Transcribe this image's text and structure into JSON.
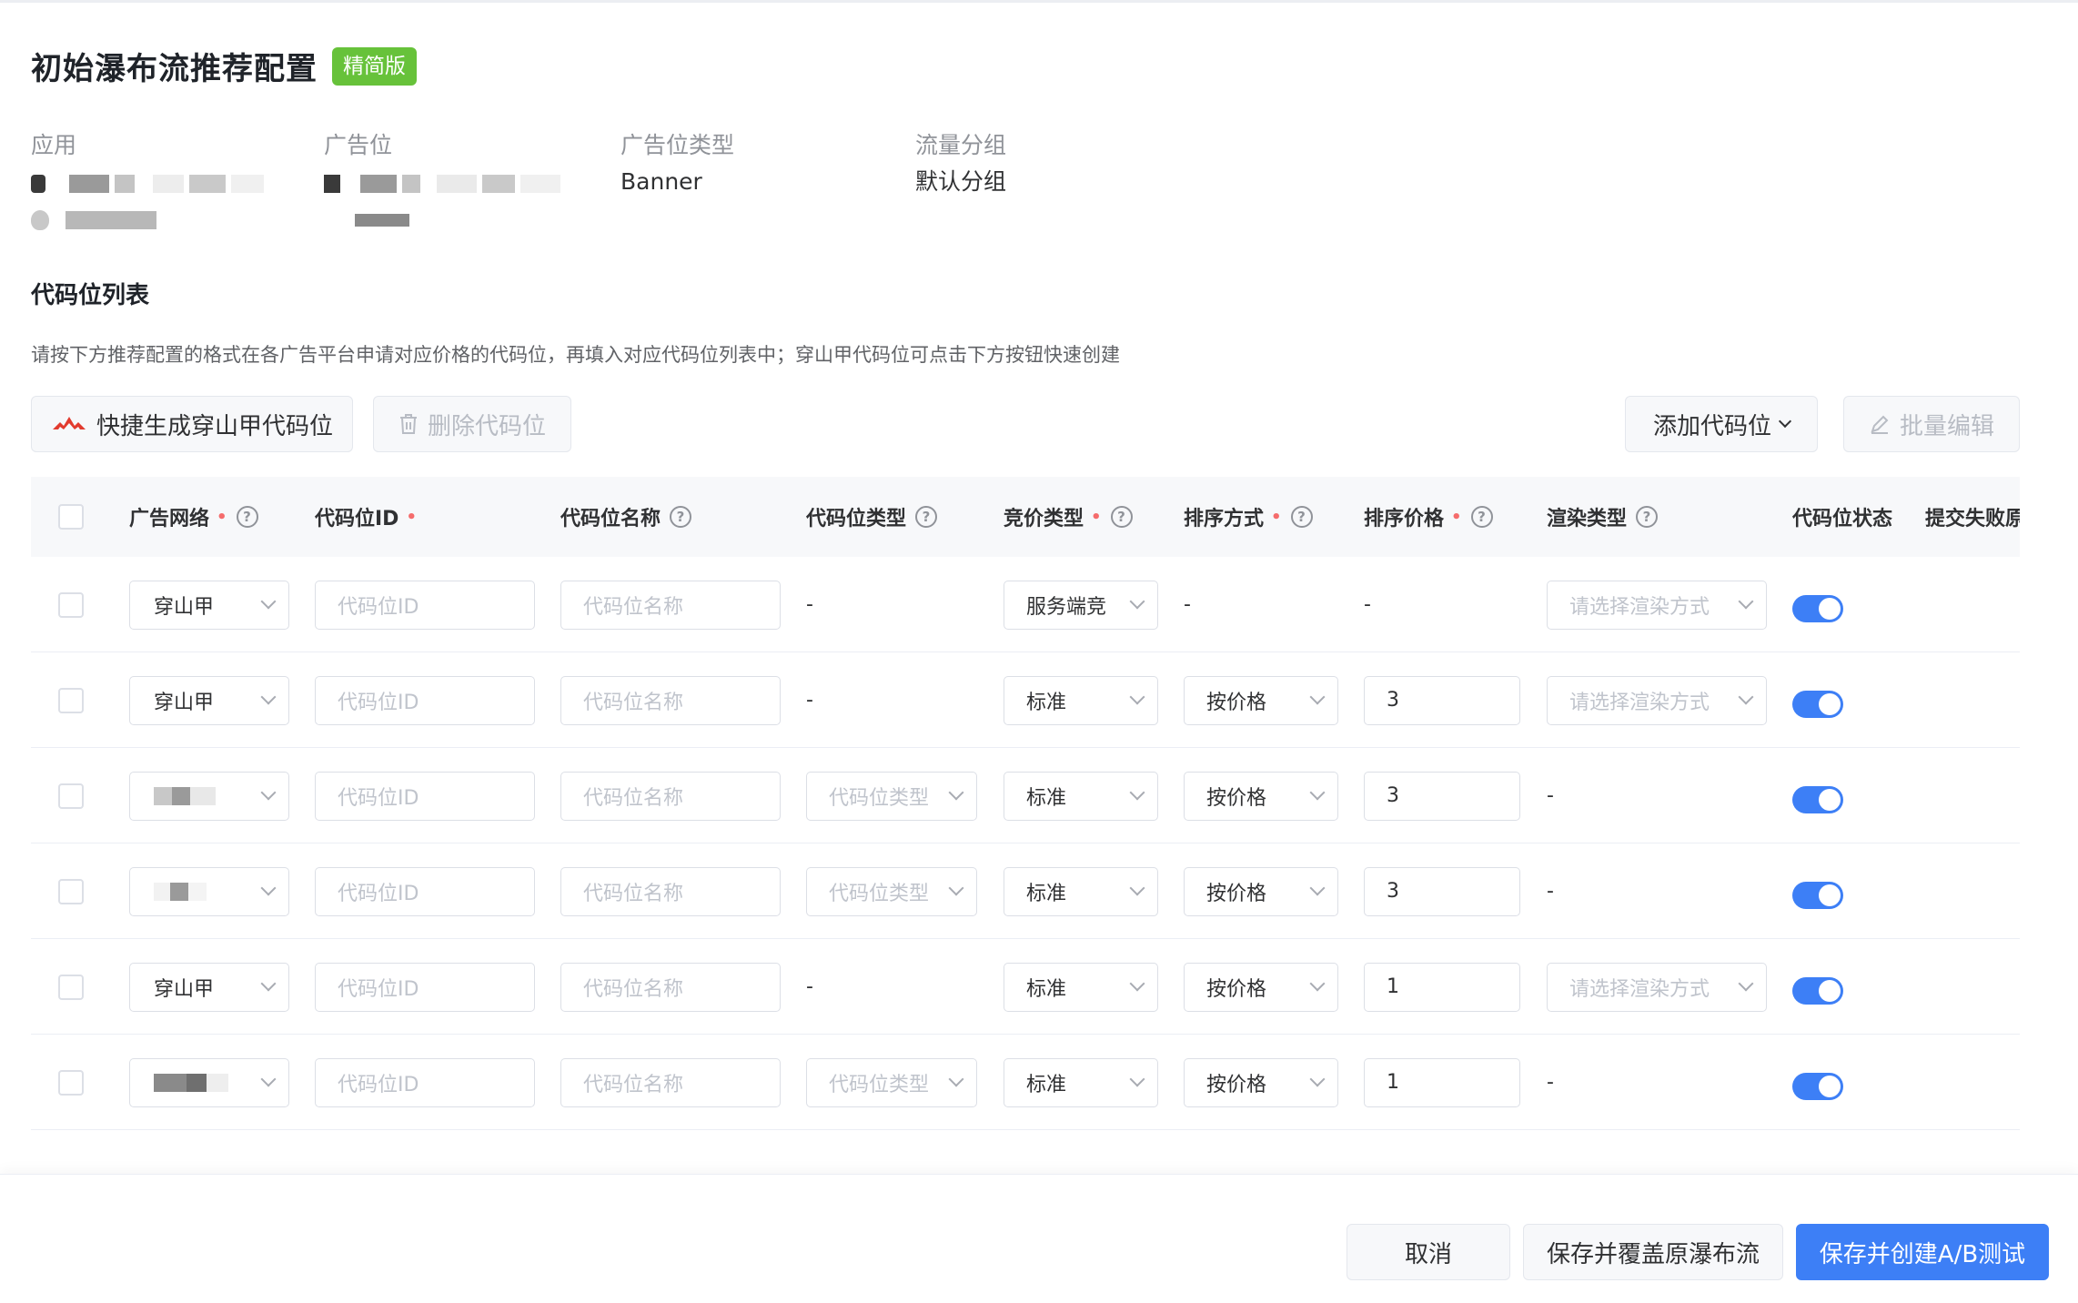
{
  "header": {
    "title": "初始瀑布流推荐配置",
    "badge": "精简版"
  },
  "info": {
    "app_label": "应用",
    "adslot_label": "广告位",
    "adslot_type_label": "广告位类型",
    "adslot_type_value": "Banner",
    "traffic_group_label": "流量分组",
    "traffic_group_value": "默认分组"
  },
  "section": {
    "title": "代码位列表",
    "description": "请按下方推荐配置的格式在各广告平台申请对应价格的代码位，再填入对应代码位列表中；穿山甲代码位可点击下方按钮快速创建"
  },
  "toolbar": {
    "quick_create_label": "快捷生成穿山甲代码位",
    "delete_label": "删除代码位",
    "add_label": "添加代码位",
    "batch_edit_label": "批量编辑"
  },
  "table": {
    "headers": {
      "network": "广告网络",
      "code_id": "代码位ID",
      "code_name": "代码位名称",
      "code_type": "代码位类型",
      "bid_type": "竞价类型",
      "sort_method": "排序方式",
      "sort_price": "排序价格",
      "render_type": "渲染类型",
      "status": "代码位状态",
      "fail_reason": "提交失败原"
    },
    "required_mark": "•",
    "help_mark": "?",
    "placeholders": {
      "code_id": "代码位ID",
      "code_name": "代码位名称",
      "code_type": "代码位类型",
      "render_type": "请选择渲染方式"
    },
    "dash": "-",
    "rows": [
      {
        "network": "穿山甲",
        "code_type": "-",
        "bid_type": "服务端竞",
        "sort_method": "-",
        "sort_price": "-",
        "render": "select"
      },
      {
        "network": "穿山甲",
        "code_type": "-",
        "bid_type": "标准",
        "sort_method": "按价格",
        "sort_price": "3",
        "render": "select"
      },
      {
        "network": "",
        "code_type": "select",
        "bid_type": "标准",
        "sort_method": "按价格",
        "sort_price": "3",
        "render": "-"
      },
      {
        "network": "",
        "code_type": "select",
        "bid_type": "标准",
        "sort_method": "按价格",
        "sort_price": "3",
        "render": "-"
      },
      {
        "network": "穿山甲",
        "code_type": "-",
        "bid_type": "标准",
        "sort_method": "按价格",
        "sort_price": "1",
        "render": "select"
      },
      {
        "network": "",
        "code_type": "select",
        "bid_type": "标准",
        "sort_method": "按价格",
        "sort_price": "1",
        "render": "-"
      }
    ]
  },
  "footer": {
    "cancel_label": "取消",
    "save_overwrite_label": "保存并覆盖原瀑布流",
    "save_ab_label": "保存并创建A/B测试"
  },
  "colors": {
    "primary": "#3d7ff6",
    "badge": "#67c23a",
    "required": "#f56c6c"
  }
}
